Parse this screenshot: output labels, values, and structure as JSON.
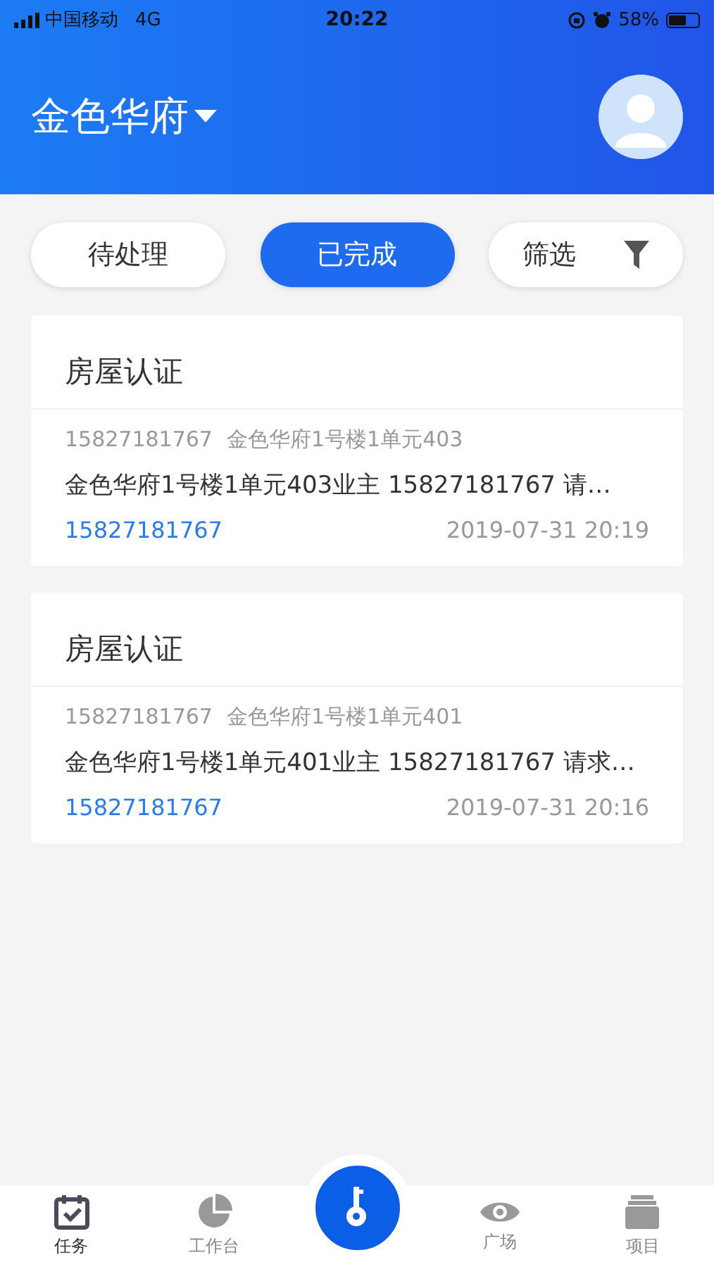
{
  "status_bar": {
    "carrier": "中国移动",
    "network": "4G",
    "time": "20:22",
    "battery_percent": "58%"
  },
  "header": {
    "title": "金色华府"
  },
  "filters": [
    {
      "label": "待处理",
      "selected": false,
      "kind": "tab"
    },
    {
      "label": "已完成",
      "selected": true,
      "kind": "tab"
    },
    {
      "label": "筛选",
      "selected": false,
      "kind": "filter"
    }
  ],
  "cards": [
    {
      "title": "房屋认证",
      "phone": "15827181767",
      "address": "金色华府1号楼1单元403",
      "description": "金色华府1号楼1单元403业主 15827181767 请…",
      "contact": "15827181767",
      "time": "2019-07-31 20:19"
    },
    {
      "title": "房屋认证",
      "phone": "15827181767",
      "address": "金色华府1号楼1单元401",
      "description": "金色华府1号楼1单元401业主 15827181767 请求…",
      "contact": "15827181767",
      "time": "2019-07-31 20:16"
    }
  ],
  "bottom_nav": [
    {
      "label": "任务",
      "selected": true,
      "kind": "tasks"
    },
    {
      "label": "工作台",
      "selected": false,
      "kind": "workbench"
    },
    {
      "kind": "center",
      "selected": false
    },
    {
      "label": "广场",
      "selected": false,
      "kind": "square"
    },
    {
      "label": "项目",
      "selected": false,
      "kind": "projects"
    }
  ]
}
